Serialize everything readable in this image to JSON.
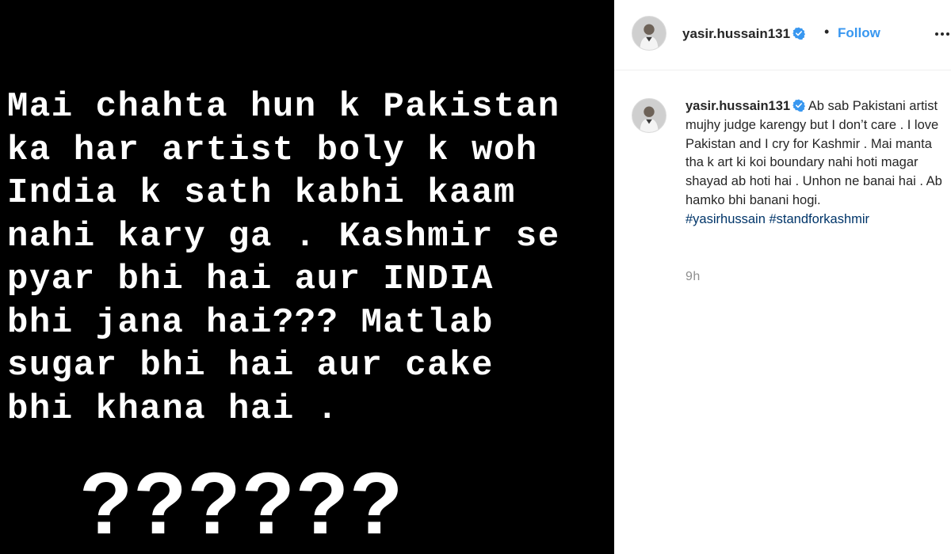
{
  "story": {
    "lines": [
      "Mai chahta hun k Pakistan",
      "ka har artist boly k woh",
      "India k sath kabhi kaam",
      "nahi kary ga . Kashmir se",
      "pyar bhi hai aur INDIA",
      "bhi jana hai??? Matlab",
      "sugar bhi hai aur cake",
      "bhi khana hai ."
    ],
    "question_marks": "??????"
  },
  "header": {
    "username": "yasir.hussain131",
    "separator": "•",
    "follow_label": "Follow",
    "more_icon": "more-horizontal-icon",
    "verified_icon": "verified-badge-icon"
  },
  "caption": {
    "username": "yasir.hussain131",
    "text": "Ab sab Pakistani artist mujhy judge karengy but I don’t care . I love Pakistan and I cry for Kashmir . Mai manta tha k art ki koi boundary nahi hoti magar shayad ab hoti hai . Unhon ne banai hai . Ab hamko bhi banani hogi.",
    "hashtags": [
      "#yasirhussain",
      "#standforkashmir"
    ],
    "timestamp": "9h"
  },
  "colors": {
    "link_blue": "#3897f0",
    "hashtag_blue": "#003569",
    "text_dark": "#262626",
    "muted_gray": "#8e8e8e",
    "image_bg": "#000000"
  }
}
